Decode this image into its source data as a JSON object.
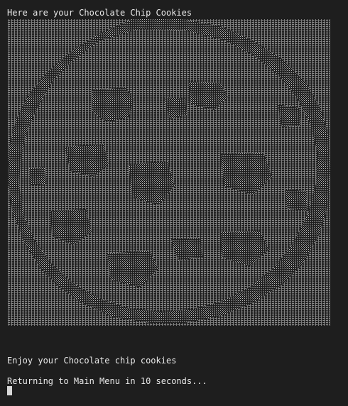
{
  "terminal": {
    "title_line": "Here are your Chocolate Chip Cookies",
    "art_description_icon": "ascii-cookie-art",
    "enjoy_line": "Enjoy your Chocolate chip cookies",
    "returning_line": "Returning to Main Menu in 10 seconds...",
    "colors": {
      "background": "#1e1e1e",
      "text": "#e8e8e8",
      "art_dense": "#9a9a9a",
      "art_light": "#5c5c5c"
    }
  }
}
